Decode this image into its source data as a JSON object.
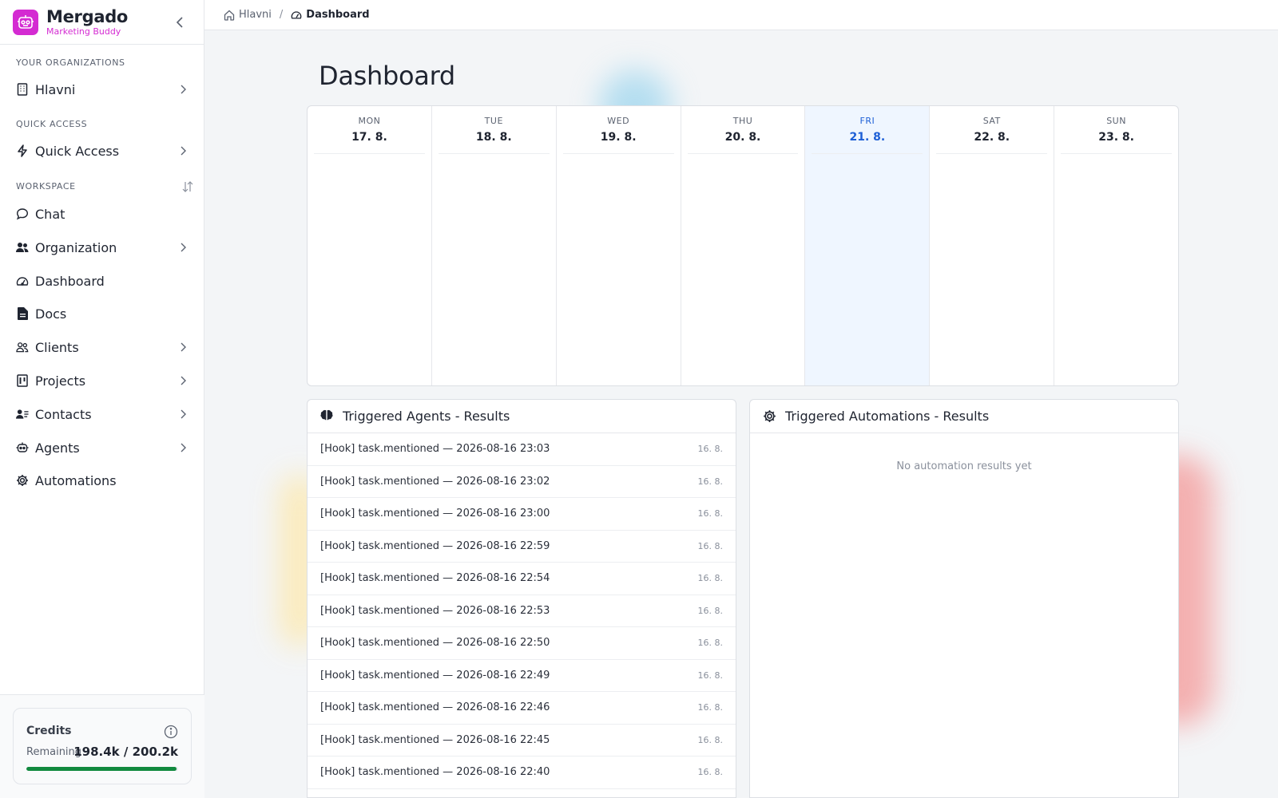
{
  "brand": {
    "name": "Mergado",
    "subtitle": "Marketing Buddy"
  },
  "sections": {
    "organizations": "YOUR ORGANIZATIONS",
    "quick_access": "QUICK ACCESS",
    "workspace": "WORKSPACE"
  },
  "nav": {
    "org": "Hlavni",
    "quick_access": "Quick Access",
    "chat": "Chat",
    "organization": "Organization",
    "dashboard": "Dashboard",
    "docs": "Docs",
    "clients": "Clients",
    "projects": "Projects",
    "contacts": "Contacts",
    "agents": "Agents",
    "automations": "Automations"
  },
  "credits": {
    "title": "Credits",
    "remaining_label": "Remaining",
    "remaining_value": "198.4k / 200.2k",
    "fraction": 0.991
  },
  "breadcrumb": {
    "home": "Hlavni",
    "separator": "/",
    "current": "Dashboard"
  },
  "page": {
    "title": "Dashboard"
  },
  "calendar": {
    "days": [
      {
        "name": "MON",
        "date": "17. 8.",
        "today": false
      },
      {
        "name": "TUE",
        "date": "18. 8.",
        "today": false
      },
      {
        "name": "WED",
        "date": "19. 8.",
        "today": false
      },
      {
        "name": "THU",
        "date": "20. 8.",
        "today": false
      },
      {
        "name": "FRI",
        "date": "21. 8.",
        "today": true
      },
      {
        "name": "SAT",
        "date": "22. 8.",
        "today": false
      },
      {
        "name": "SUN",
        "date": "23. 8.",
        "today": false
      }
    ]
  },
  "agents_panel": {
    "title": "Triggered Agents - Results",
    "items": [
      {
        "text": "[Hook] task.mentioned — 2026-08-16 23:03",
        "date": "16. 8."
      },
      {
        "text": "[Hook] task.mentioned — 2026-08-16 23:02",
        "date": "16. 8."
      },
      {
        "text": "[Hook] task.mentioned — 2026-08-16 23:00",
        "date": "16. 8."
      },
      {
        "text": "[Hook] task.mentioned — 2026-08-16 22:59",
        "date": "16. 8."
      },
      {
        "text": "[Hook] task.mentioned — 2026-08-16 22:54",
        "date": "16. 8."
      },
      {
        "text": "[Hook] task.mentioned — 2026-08-16 22:53",
        "date": "16. 8."
      },
      {
        "text": "[Hook] task.mentioned — 2026-08-16 22:50",
        "date": "16. 8."
      },
      {
        "text": "[Hook] task.mentioned — 2026-08-16 22:49",
        "date": "16. 8."
      },
      {
        "text": "[Hook] task.mentioned — 2026-08-16 22:46",
        "date": "16. 8."
      },
      {
        "text": "[Hook] task.mentioned — 2026-08-16 22:45",
        "date": "16. 8."
      },
      {
        "text": "[Hook] task.mentioned — 2026-08-16 22:40",
        "date": "16. 8."
      }
    ]
  },
  "automations_panel": {
    "title": "Triggered Automations - Results",
    "empty": "No automation results yet"
  },
  "colors": {
    "brand": "#d42bd2",
    "today": "#1d5fd6",
    "credits_bar": "#128a3f"
  },
  "icons": {
    "logo": "robot-logo-icon",
    "collapse": "chevron-left-icon",
    "org": "building-icon",
    "quick_access": "bolt-icon",
    "chat": "chat-bubble-icon",
    "organization": "users-icon",
    "dashboard": "gauge-icon",
    "docs": "document-icon",
    "clients": "clients-icon",
    "projects": "kanban-icon",
    "contacts": "contact-card-icon",
    "agents": "robot-icon",
    "automations": "gear-icon",
    "info": "info-icon",
    "home": "home-icon",
    "sort": "sort-icon"
  }
}
